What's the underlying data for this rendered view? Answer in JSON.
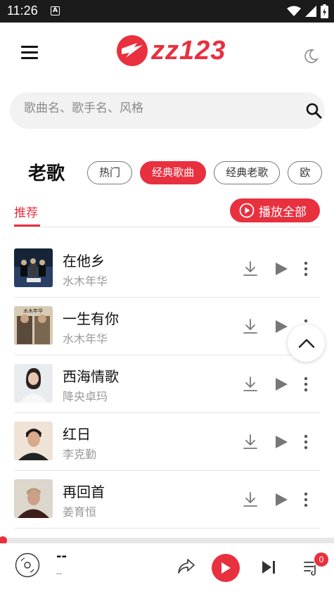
{
  "status_bar": {
    "time": "11:26",
    "notification_icon_letter": "A"
  },
  "header": {
    "logo_text": "zz123",
    "menu_icon": "hamburger-menu-icon",
    "theme_icon": "moon-icon"
  },
  "search": {
    "placeholder": "歌曲名、歌手名、风格"
  },
  "category": {
    "title": "老歌",
    "chips": [
      {
        "label": "热门",
        "active": false
      },
      {
        "label": "经典歌曲",
        "active": true
      },
      {
        "label": "经典老歌",
        "active": false
      },
      {
        "label": "欧",
        "active": false
      }
    ]
  },
  "tabs": {
    "recommend_label": "推荐"
  },
  "play_all": {
    "label": "播放全部"
  },
  "songs": [
    {
      "title": "在他乡",
      "artist": "水木年华"
    },
    {
      "title": "一生有你",
      "artist": "水木年华",
      "cover_caption": "水木年华"
    },
    {
      "title": "西海情歌",
      "artist": "降央卓玛"
    },
    {
      "title": "红日",
      "artist": "李克勤"
    },
    {
      "title": "再回首",
      "artist": "姜育恒"
    }
  ],
  "now_playing": {
    "title": "--",
    "artist": "--",
    "queue_count": "0",
    "progress": 0
  },
  "colors": {
    "accent": "#e8303f",
    "status_bar": "#1b1b1b",
    "divider": "#e6e6e6",
    "muted_text": "#999999"
  }
}
